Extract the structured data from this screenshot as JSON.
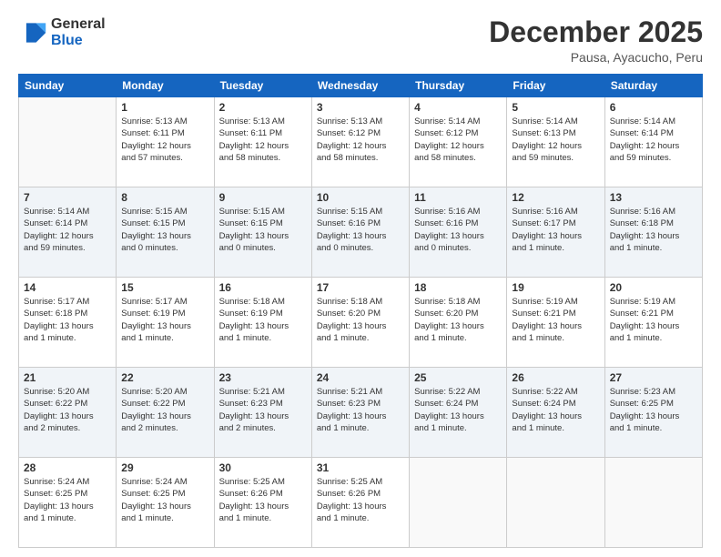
{
  "logo": {
    "line1": "General",
    "line2": "Blue"
  },
  "title": "December 2025",
  "subtitle": "Pausa, Ayacucho, Peru",
  "weekdays": [
    "Sunday",
    "Monday",
    "Tuesday",
    "Wednesday",
    "Thursday",
    "Friday",
    "Saturday"
  ],
  "weeks": [
    [
      {
        "day": "",
        "info": ""
      },
      {
        "day": "1",
        "info": "Sunrise: 5:13 AM\nSunset: 6:11 PM\nDaylight: 12 hours\nand 57 minutes."
      },
      {
        "day": "2",
        "info": "Sunrise: 5:13 AM\nSunset: 6:11 PM\nDaylight: 12 hours\nand 58 minutes."
      },
      {
        "day": "3",
        "info": "Sunrise: 5:13 AM\nSunset: 6:12 PM\nDaylight: 12 hours\nand 58 minutes."
      },
      {
        "day": "4",
        "info": "Sunrise: 5:14 AM\nSunset: 6:12 PM\nDaylight: 12 hours\nand 58 minutes."
      },
      {
        "day": "5",
        "info": "Sunrise: 5:14 AM\nSunset: 6:13 PM\nDaylight: 12 hours\nand 59 minutes."
      },
      {
        "day": "6",
        "info": "Sunrise: 5:14 AM\nSunset: 6:14 PM\nDaylight: 12 hours\nand 59 minutes."
      }
    ],
    [
      {
        "day": "7",
        "info": "Sunrise: 5:14 AM\nSunset: 6:14 PM\nDaylight: 12 hours\nand 59 minutes."
      },
      {
        "day": "8",
        "info": "Sunrise: 5:15 AM\nSunset: 6:15 PM\nDaylight: 13 hours\nand 0 minutes."
      },
      {
        "day": "9",
        "info": "Sunrise: 5:15 AM\nSunset: 6:15 PM\nDaylight: 13 hours\nand 0 minutes."
      },
      {
        "day": "10",
        "info": "Sunrise: 5:15 AM\nSunset: 6:16 PM\nDaylight: 13 hours\nand 0 minutes."
      },
      {
        "day": "11",
        "info": "Sunrise: 5:16 AM\nSunset: 6:16 PM\nDaylight: 13 hours\nand 0 minutes."
      },
      {
        "day": "12",
        "info": "Sunrise: 5:16 AM\nSunset: 6:17 PM\nDaylight: 13 hours\nand 1 minute."
      },
      {
        "day": "13",
        "info": "Sunrise: 5:16 AM\nSunset: 6:18 PM\nDaylight: 13 hours\nand 1 minute."
      }
    ],
    [
      {
        "day": "14",
        "info": "Sunrise: 5:17 AM\nSunset: 6:18 PM\nDaylight: 13 hours\nand 1 minute."
      },
      {
        "day": "15",
        "info": "Sunrise: 5:17 AM\nSunset: 6:19 PM\nDaylight: 13 hours\nand 1 minute."
      },
      {
        "day": "16",
        "info": "Sunrise: 5:18 AM\nSunset: 6:19 PM\nDaylight: 13 hours\nand 1 minute."
      },
      {
        "day": "17",
        "info": "Sunrise: 5:18 AM\nSunset: 6:20 PM\nDaylight: 13 hours\nand 1 minute."
      },
      {
        "day": "18",
        "info": "Sunrise: 5:18 AM\nSunset: 6:20 PM\nDaylight: 13 hours\nand 1 minute."
      },
      {
        "day": "19",
        "info": "Sunrise: 5:19 AM\nSunset: 6:21 PM\nDaylight: 13 hours\nand 1 minute."
      },
      {
        "day": "20",
        "info": "Sunrise: 5:19 AM\nSunset: 6:21 PM\nDaylight: 13 hours\nand 1 minute."
      }
    ],
    [
      {
        "day": "21",
        "info": "Sunrise: 5:20 AM\nSunset: 6:22 PM\nDaylight: 13 hours\nand 2 minutes."
      },
      {
        "day": "22",
        "info": "Sunrise: 5:20 AM\nSunset: 6:22 PM\nDaylight: 13 hours\nand 2 minutes."
      },
      {
        "day": "23",
        "info": "Sunrise: 5:21 AM\nSunset: 6:23 PM\nDaylight: 13 hours\nand 2 minutes."
      },
      {
        "day": "24",
        "info": "Sunrise: 5:21 AM\nSunset: 6:23 PM\nDaylight: 13 hours\nand 1 minute."
      },
      {
        "day": "25",
        "info": "Sunrise: 5:22 AM\nSunset: 6:24 PM\nDaylight: 13 hours\nand 1 minute."
      },
      {
        "day": "26",
        "info": "Sunrise: 5:22 AM\nSunset: 6:24 PM\nDaylight: 13 hours\nand 1 minute."
      },
      {
        "day": "27",
        "info": "Sunrise: 5:23 AM\nSunset: 6:25 PM\nDaylight: 13 hours\nand 1 minute."
      }
    ],
    [
      {
        "day": "28",
        "info": "Sunrise: 5:24 AM\nSunset: 6:25 PM\nDaylight: 13 hours\nand 1 minute."
      },
      {
        "day": "29",
        "info": "Sunrise: 5:24 AM\nSunset: 6:25 PM\nDaylight: 13 hours\nand 1 minute."
      },
      {
        "day": "30",
        "info": "Sunrise: 5:25 AM\nSunset: 6:26 PM\nDaylight: 13 hours\nand 1 minute."
      },
      {
        "day": "31",
        "info": "Sunrise: 5:25 AM\nSunset: 6:26 PM\nDaylight: 13 hours\nand 1 minute."
      },
      {
        "day": "",
        "info": ""
      },
      {
        "day": "",
        "info": ""
      },
      {
        "day": "",
        "info": ""
      }
    ]
  ]
}
